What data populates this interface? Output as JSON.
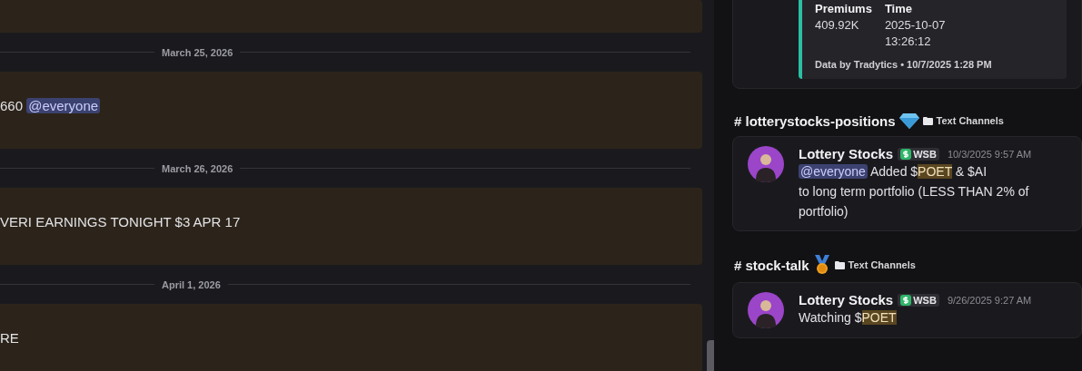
{
  "chat": {
    "items": [
      {
        "kind": "message"
      },
      {
        "kind": "date",
        "text": "March 25, 2026"
      },
      {
        "kind": "message",
        "lines": [
          [
            {
              "kind": "text",
              "text": "660 "
            },
            {
              "kind": "mention",
              "text": "@everyone"
            }
          ]
        ]
      },
      {
        "kind": "date",
        "text": "March 26, 2026"
      },
      {
        "kind": "message",
        "lines": [
          [
            {
              "kind": "text",
              "text": "VERI EARNINGS TONIGHT $3 APR 17"
            }
          ]
        ]
      },
      {
        "kind": "date",
        "text": "April 1, 2026"
      },
      {
        "kind": "message",
        "lines": [
          [
            {
              "kind": "text",
              "text": "RE"
            }
          ]
        ]
      }
    ]
  },
  "results": [
    {
      "kind": "embed",
      "fields": [
        {
          "name": "Premiums",
          "value": [
            "409.92K"
          ]
        },
        {
          "name": "Time",
          "value": [
            "2025-10-07",
            "13:26:12"
          ]
        }
      ],
      "footer": "Data by Tradytics • 10/7/2025 1:28 PM"
    },
    {
      "kind": "post",
      "channel": "lotterystocks-positions",
      "hash": "#",
      "channel_icon": {
        "kind": "diamond"
      },
      "category": "Text Channels",
      "author": "Lottery Stocks",
      "badge": "WSB",
      "time": "10/3/2025 9:57 AM",
      "lines": [
        [
          {
            "kind": "mention",
            "text": "@everyone"
          },
          {
            "kind": "text",
            "text": " Added $"
          },
          {
            "kind": "highlight",
            "text": "POET"
          },
          {
            "kind": "text",
            "text": " & $AI"
          }
        ],
        [
          {
            "kind": "text",
            "text": "to long term portfolio (LESS THAN 2% of portfolio)"
          }
        ]
      ]
    },
    {
      "kind": "post",
      "channel": "stock-talk",
      "hash": "#",
      "channel_icon": {
        "kind": "medal"
      },
      "category": "Text Channels",
      "author": "Lottery Stocks",
      "badge": "WSB",
      "time": "9/26/2025 9:27 AM",
      "lines": [
        [
          {
            "kind": "text",
            "text": "Watching $"
          },
          {
            "kind": "highlight",
            "text": "POET"
          }
        ]
      ]
    }
  ]
}
